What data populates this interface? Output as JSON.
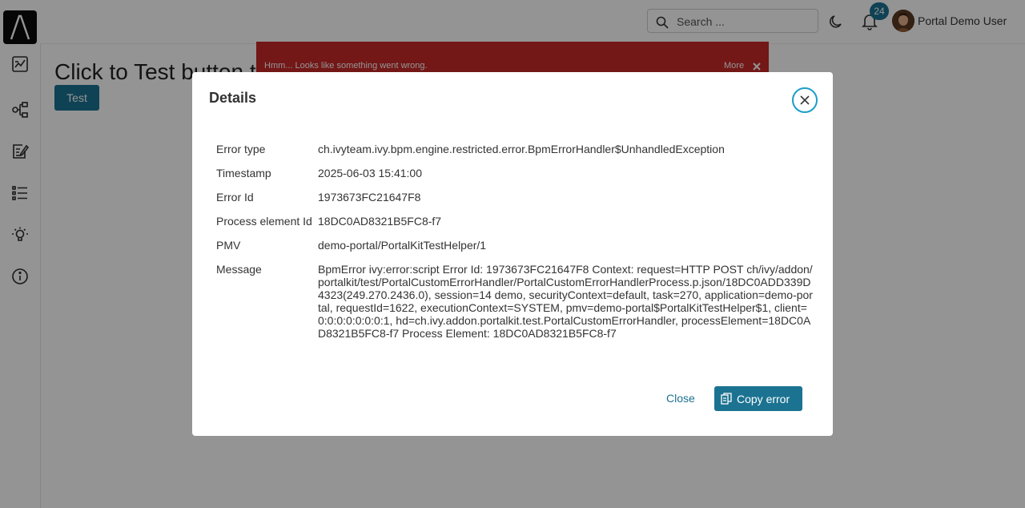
{
  "header": {
    "search": {
      "placeholder": "Search ..."
    },
    "notifications": {
      "count": "24"
    },
    "user": {
      "name": "Portal Demo User"
    }
  },
  "sidebar": {
    "items": [
      {
        "icon": "dashboard-icon"
      },
      {
        "icon": "process-icon"
      },
      {
        "icon": "task-icon"
      },
      {
        "icon": "case-list-icon"
      },
      {
        "icon": "idea-icon"
      },
      {
        "icon": "info-icon"
      }
    ]
  },
  "page": {
    "title": "Click to Test button t",
    "test_button": "Test",
    "banner": {
      "message": "Hmm... Looks like something went wrong.",
      "more": "More"
    }
  },
  "dialog": {
    "title": "Details",
    "rows": [
      {
        "label": "Error type",
        "value": "ch.ivyteam.ivy.bpm.engine.restricted.error.BpmErrorHandler$UnhandledException"
      },
      {
        "label": "Timestamp",
        "value": "2025-06-03 15:41:00"
      },
      {
        "label": "Error Id",
        "value": "1973673FC21647F8"
      },
      {
        "label": "Process element Id",
        "value": "18DC0AD8321B5FC8-f7"
      },
      {
        "label": "PMV",
        "value": "demo-portal/PortalKitTestHelper/1"
      },
      {
        "label": "Message",
        "value": "BpmError ivy:error:script Error Id: 1973673FC21647F8 Context: request=HTTP POST ch/ivy/addon/portalkit/test/PortalCustomErrorHandler/PortalCustomErrorHandlerProcess.p.json/18DC0ADD339D4323(249.270.2436.0), session=14 demo, securityContext=default, task=270, application=demo-portal, requestId=1622, executionContext=SYSTEM, pmv=demo-portal$PortalKitTestHelper$1, client=0:0:0:0:0:0:0:1, hd=ch.ivy.addon.portalkit.test.PortalCustomErrorHandler, processElement=18DC0AD8321B5FC8-f7 Process Element: 18DC0AD8321B5FC8-f7"
      }
    ],
    "close_label": "Close",
    "copy_label": "Copy error"
  },
  "colors": {
    "primary": "#1b7391",
    "banner": "#c62828",
    "focus_ring": "#1b9ec7"
  }
}
